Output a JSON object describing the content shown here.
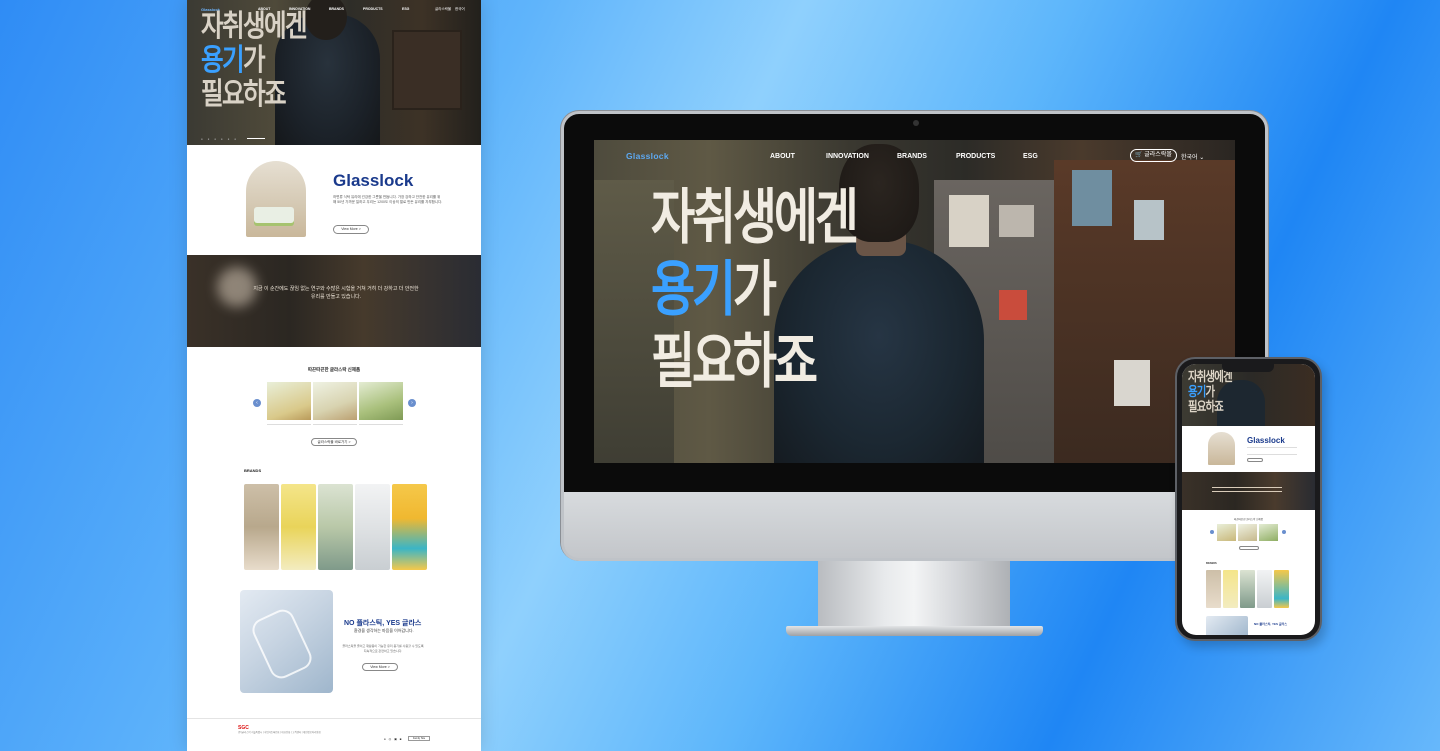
{
  "site": {
    "logo": "Glasslock",
    "nav": [
      "ABOUT",
      "INNOVATION",
      "BRANDS",
      "PRODUCTS",
      "ESG"
    ],
    "shop_button": "글라스락몰",
    "language": "한국어"
  },
  "hero": {
    "line1": "자취생에겐",
    "line2_accent": "용기",
    "line2_rest": "가",
    "line3": "필요하죠"
  },
  "brand_intro": {
    "title": "Glasslock",
    "description": "하면류 식탁 유리에 건강한 그릇을 만듭니다. 가장 강하고 안전한 유리를 위해 50년 가까운 일하고 우리는 1200도 이상의 열로 만든 유리를 자부합니다.",
    "button": "View More >"
  },
  "story": {
    "text": "지금 이 순간에도 끊임 없는 연구와 수많은 시험을 거쳐 거히 더 강하고 더 안전한 유리를 만들고 있습니다."
  },
  "new_products": {
    "heading": "따끈따끈한 글라스락 신제품",
    "arrow_prev": "‹",
    "arrow_next": "›",
    "button": "글라스락몰 바로가기 >"
  },
  "brands": {
    "heading": "BRANDS"
  },
  "eco": {
    "title": "NO 플라스틱, YES 글라스",
    "subtitle": "환경을 생각하는 마음을 이어갑니다.",
    "description": "플라스틱을 줄이고 재활용이 가능한 유리 용기를 사용할 수 있도록 지속적으로 관련하고 있습니다.",
    "button": "View More >"
  },
  "footer": {
    "group_logo": "SGC",
    "info": "(주)글라스락 서울특별시 | 사업자등록번호 | 대표전화 | 고객센터 | 개인정보처리방침",
    "sns": "● ◎ ▣ ■",
    "family_site": "Family Site"
  },
  "colors": {
    "brand_blue": "#1a3a8c",
    "accent_blue": "#3aa0ff"
  }
}
